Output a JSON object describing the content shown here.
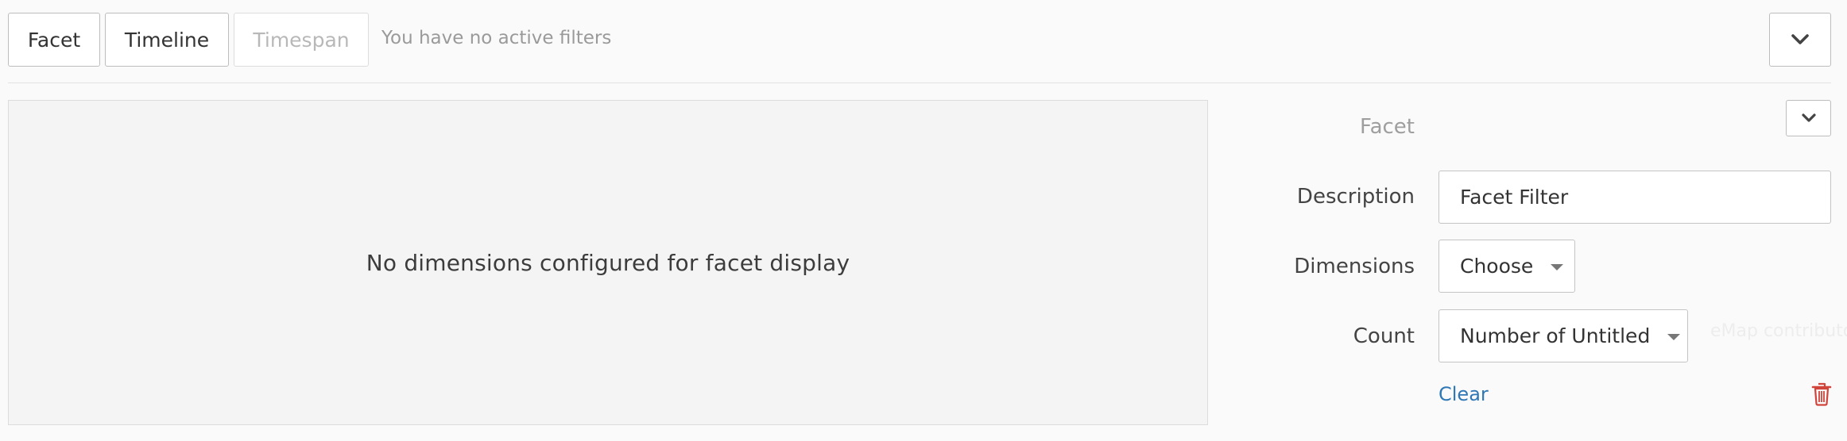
{
  "toolbar": {
    "facet_label": "Facet",
    "timeline_label": "Timeline",
    "timespan_label": "Timespan",
    "active_filters_text": "You have no active filters",
    "collapse_icon": "chevron-down-icon"
  },
  "preview": {
    "empty_message": "No dimensions configured for facet display"
  },
  "settings": {
    "header_label": "Facet",
    "collapse_icon": "chevron-down-icon",
    "description_label": "Description",
    "description_value": "Facet Filter",
    "dimensions_label": "Dimensions",
    "dimensions_value": "Choose",
    "count_label": "Count",
    "count_value": "Number of Untitled",
    "clear_label": "Clear",
    "delete_icon": "trash-icon"
  },
  "background": {
    "faint_attribution": "eMap contributors"
  },
  "colors": {
    "link": "#2f78b5",
    "danger": "#d0443b",
    "disabled_text": "#b8b8b8",
    "muted_text": "#9a9a9a"
  }
}
